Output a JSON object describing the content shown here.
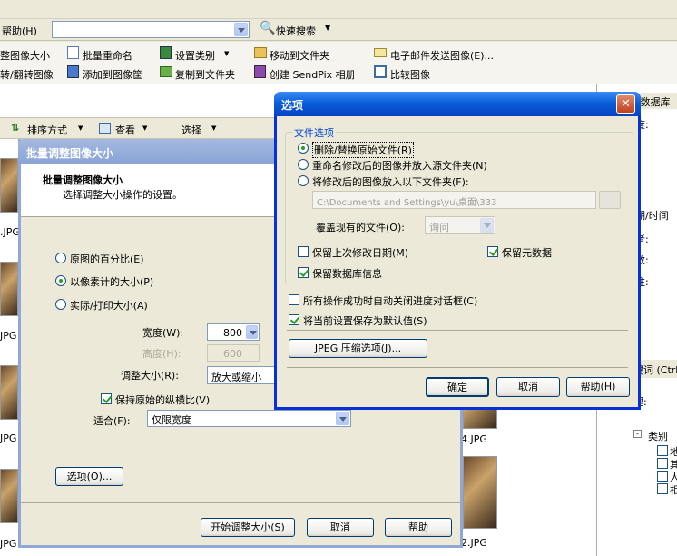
{
  "menubar": {
    "help": "帮助(H)",
    "quick_search": "快速搜索"
  },
  "toolbar1": {
    "resize": "整图像大小",
    "batch_rename": "批量重命名",
    "set_category": "设置类别",
    "move_to_folder": "移动到文件夹",
    "email": "电子邮件发送图像(E)..."
  },
  "toolbar2": {
    "rotate": "转/翻转图像",
    "add_to_tray": "添加到图像筐",
    "copy_to_folder": "复制到文件夹",
    "create_sendpix": "创建 SendPix 相册",
    "compare": "比较图像"
  },
  "toolbar3": {
    "sort": "排序方式",
    "view": "查看",
    "select": "选择"
  },
  "thumbs": {
    "labels": [
      ".JPG",
      "JPG",
      "JPG",
      "JPG",
      "JPG",
      "4.JPG",
      "2.JPG"
    ]
  },
  "rightpanel": {
    "title": "- 数据库",
    "l1": "度:",
    "l2": "期/时间",
    "l3": "者:",
    "l4": "数:",
    "l5": "注:",
    "l6": "键词 (Ctrl",
    "l7": "理:",
    "tree_root": "类别",
    "tree": [
      "地",
      "其",
      "人",
      "相"
    ]
  },
  "batch": {
    "title": "批量调整图像大小",
    "heading": "批量调整图像大小",
    "subheading": "选择调整大小操作的设置。",
    "opt_percent": "原图的百分比(E)",
    "opt_pixels": "以像素计的大小(P)",
    "opt_print": "实际/打印大小(A)",
    "width_label": "宽度(W):",
    "width_value": "800",
    "height_label": "高度(H):",
    "height_value": "600",
    "resize_label": "调整大小(R):",
    "resize_value": "放大或缩小",
    "keep_ratio": "保持原始的纵横比(V)",
    "fit_label": "适合(F):",
    "fit_value": "仅限宽度",
    "options_btn": "选项(O)...",
    "start_btn": "开始调整大小(S)",
    "cancel_btn": "取消",
    "help_btn": "帮助"
  },
  "options": {
    "title": "选项",
    "group": "文件选项",
    "r1": "删除/替换原始文件(R)",
    "r2": "重命名修改后的图像并放入源文件夹(N)",
    "r3": "将修改后的图像放入以下文件夹(F):",
    "path": "C:\\Documents and Settings\\yu\\桌面\\333",
    "overwrite_label": "覆盖现有的文件(O):",
    "overwrite_value": "询问",
    "keep_date": "保留上次修改日期(M)",
    "keep_meta": "保留元数据",
    "keep_db": "保留数据库信息",
    "auto_close": "所有操作成功时自动关闭进度对话框(C)",
    "save_default": "将当前设置保存为默认值(S)",
    "jpeg_btn": "JPEG 压缩选项(J)...",
    "ok": "确定",
    "cancel": "取消",
    "help": "帮助(H)"
  }
}
